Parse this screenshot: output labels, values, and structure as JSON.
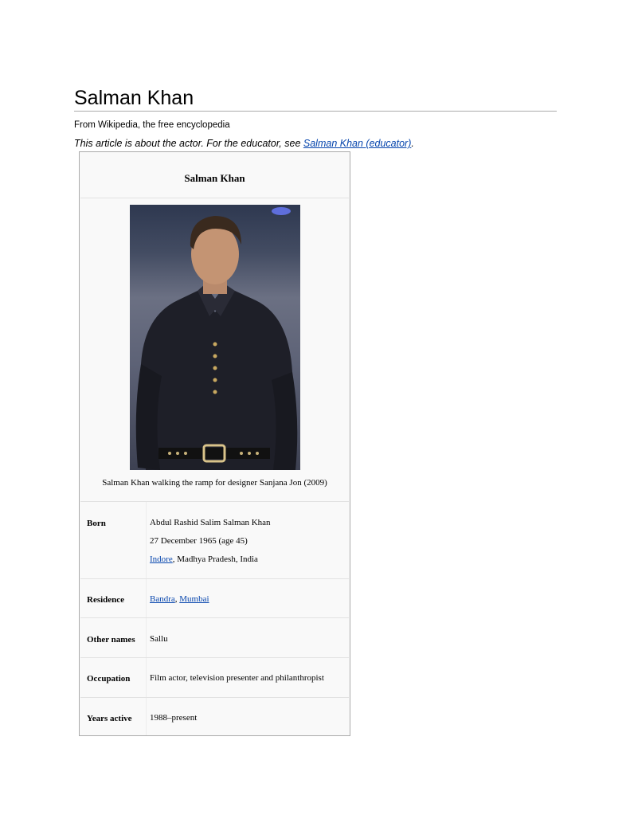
{
  "page": {
    "title": "Salman Khan",
    "site_subtitle": "From Wikipedia, the free encyclopedia",
    "hatnote": {
      "prefix": "This article is about the actor. For the educator, see ",
      "link_text": "Salman Khan (educator)",
      "suffix": "."
    }
  },
  "infobox": {
    "title": "Salman Khan",
    "image_caption": "Salman Khan walking the ramp for designer Sanjana Jon (2009)",
    "rows": {
      "born": {
        "label": "Born",
        "name": "Abdul Rashid Salim Salman Khan",
        "date": "27 December 1965 (age 45)",
        "place_link": "Indore",
        "place_rest": ", Madhya Pradesh, India"
      },
      "residence": {
        "label": "Residence",
        "link1": "Bandra",
        "sep": ", ",
        "link2": "Mumbai"
      },
      "other_names": {
        "label": "Other names",
        "value": "Sallu"
      },
      "occupation": {
        "label": "Occupation",
        "value": "Film actor, television presenter and philanthropist"
      },
      "years_active": {
        "label": "Years active",
        "value": "1988–present"
      }
    }
  },
  "colors": {
    "link": "#0645ad",
    "infobox_bg": "#f9f9f9",
    "infobox_border": "#aaaaaa"
  }
}
